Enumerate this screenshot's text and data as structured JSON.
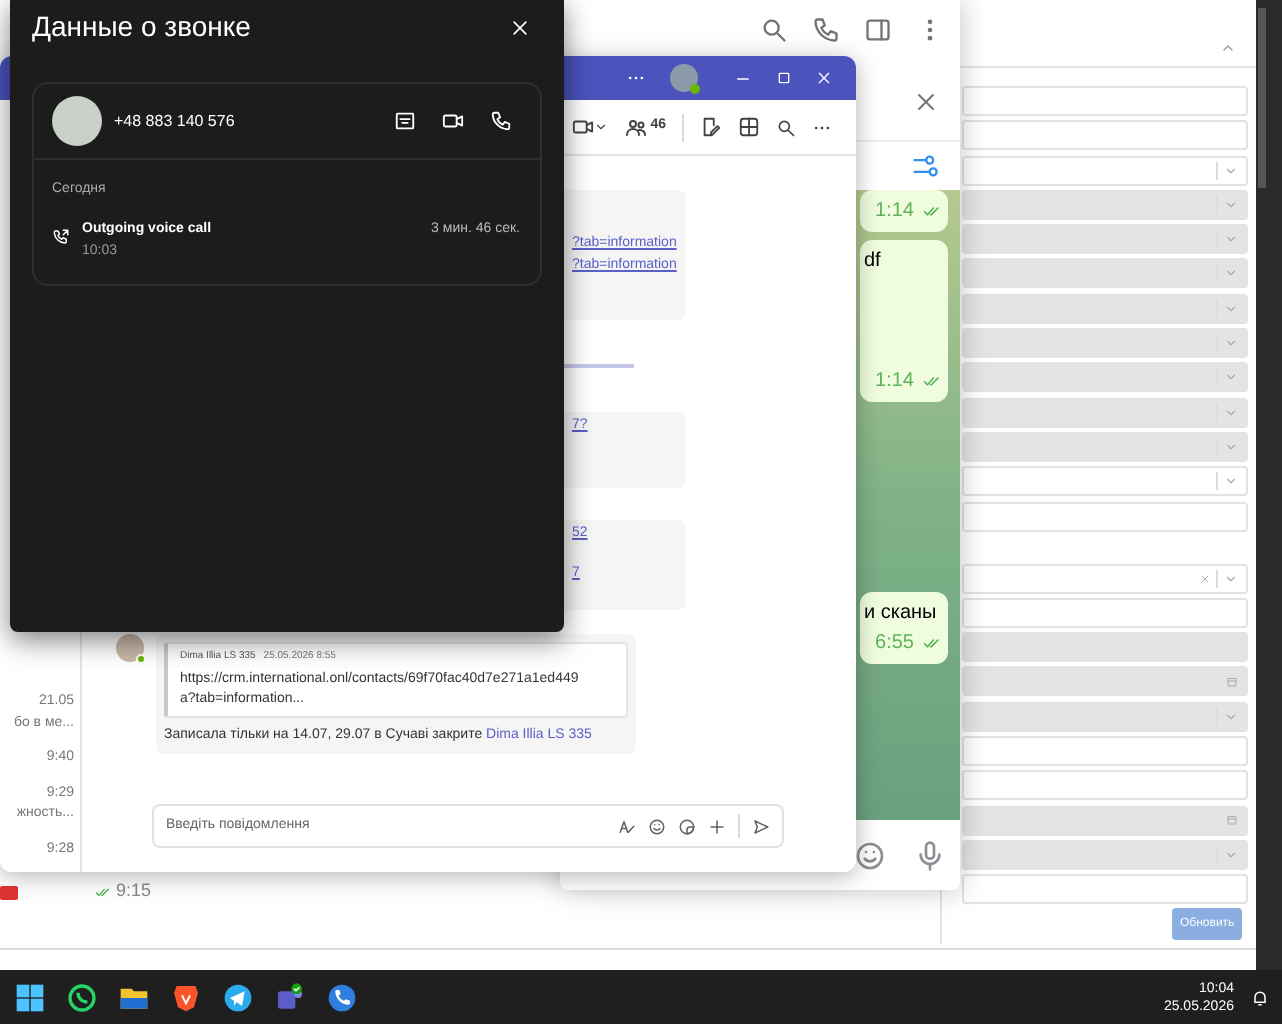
{
  "crm": {
    "groups": [
      {
        "fields": [
          {
            "kind": "input",
            "disabled": false
          },
          {
            "kind": "input",
            "disabled": false
          },
          {
            "kind": "select",
            "disabled": false
          },
          {
            "kind": "select",
            "disabled": true
          },
          {
            "kind": "select",
            "disabled": true
          },
          {
            "kind": "select",
            "disabled": true
          },
          {
            "kind": "select",
            "disabled": true
          },
          {
            "kind": "select",
            "disabled": true
          },
          {
            "kind": "select",
            "disabled": true
          },
          {
            "kind": "select",
            "disabled": true
          },
          {
            "kind": "select",
            "disabled": true
          },
          {
            "kind": "select",
            "disabled": false
          },
          {
            "kind": "input",
            "disabled": false
          }
        ]
      },
      {
        "fields": [
          {
            "kind": "clearable",
            "disabled": false
          },
          {
            "kind": "input",
            "disabled": false
          },
          {
            "kind": "input",
            "disabled": true
          },
          {
            "kind": "date",
            "disabled": true
          },
          {
            "kind": "select",
            "disabled": true
          },
          {
            "kind": "input",
            "disabled": false
          },
          {
            "kind": "input",
            "disabled": false
          },
          {
            "kind": "date",
            "disabled": true
          },
          {
            "kind": "select",
            "disabled": true
          },
          {
            "kind": "input",
            "disabled": false
          }
        ]
      }
    ],
    "button": "Обновить"
  },
  "background_chat": {
    "time": "9:15"
  },
  "telegram": {
    "messages": [
      {
        "time": "1:14",
        "read": true
      },
      {
        "text": "df",
        "time": "1:14",
        "read": true
      },
      {
        "text": "и сканы",
        "time": "6:55",
        "read": true
      }
    ]
  },
  "teams": {
    "people_count": "46",
    "chat_list": [
      {
        "time": "21.05",
        "preview": "бо в ме..."
      },
      {
        "time": "9:40"
      },
      {
        "time": "9:29",
        "preview": "жность..."
      },
      {
        "time": "9:28"
      }
    ],
    "bubbles": [
      {
        "lines": [
          "?tab=information",
          "?tab=information"
        ]
      },
      {
        "lines": [
          "7?"
        ]
      },
      {
        "lines": [
          "52",
          "7"
        ]
      }
    ],
    "post": {
      "quote": {
        "author": "Dima Illia LS 335",
        "date": "25.05.2026 8:55",
        "text": "https://crm.international.onl/contacts/69f70fac40d7e271a1ed449a?tab=information..."
      },
      "text": "Записала тільки на 14.07, 29.07 в Сучаві закрите ",
      "mention": "Dima Illia LS 335"
    },
    "composer": {
      "placeholder": "Введіть повідомлення"
    }
  },
  "call_details": {
    "title": "Данные о звонке",
    "phone": "+48 883 140 576",
    "section": "Сегодня",
    "calls": [
      {
        "kind": "outgoing",
        "label": "Outgoing voice call",
        "time": "10:03",
        "duration": "3 мин. 46 сек."
      }
    ]
  },
  "taskbar": {
    "apps": [
      {
        "kind": "start"
      },
      {
        "kind": "whatsapp"
      },
      {
        "kind": "files"
      },
      {
        "kind": "browser"
      },
      {
        "kind": "telegram"
      },
      {
        "kind": "teams"
      },
      {
        "kind": "phone"
      }
    ],
    "time": "10:04",
    "date": "25.05.2026"
  }
}
